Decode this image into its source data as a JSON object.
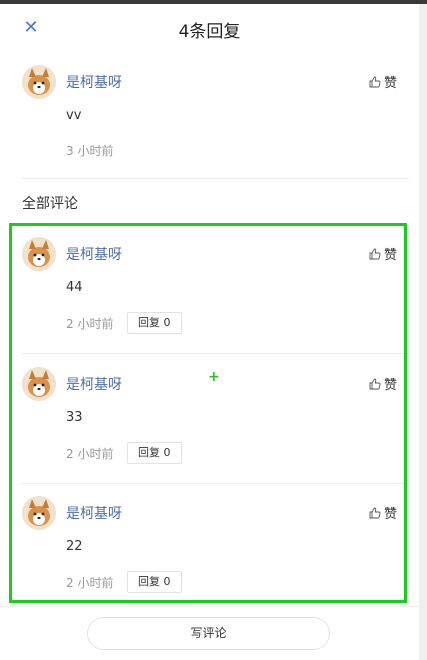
{
  "header": {
    "close_icon": "close-icon",
    "title": "4条回复"
  },
  "original_comment": {
    "author": "是柯基呀",
    "like_label": "赞",
    "text": "vv",
    "time": "3 小时前"
  },
  "section_title": "全部评论",
  "replies": [
    {
      "author": "是柯基呀",
      "like_label": "赞",
      "text": "44",
      "time": "2 小时前",
      "reply_label": "回复 0"
    },
    {
      "author": "是柯基呀",
      "like_label": "赞",
      "text": "33",
      "time": "2 小时前",
      "reply_label": "回复 0"
    },
    {
      "author": "是柯基呀",
      "like_label": "赞",
      "text": "22",
      "time": "2 小时前",
      "reply_label": "回复 0"
    }
  ],
  "bottom": {
    "write_label": "写评论"
  },
  "colors": {
    "accent": "#4a7bd6",
    "author": "#4d6fa6",
    "highlight": "#1ccb1c"
  }
}
